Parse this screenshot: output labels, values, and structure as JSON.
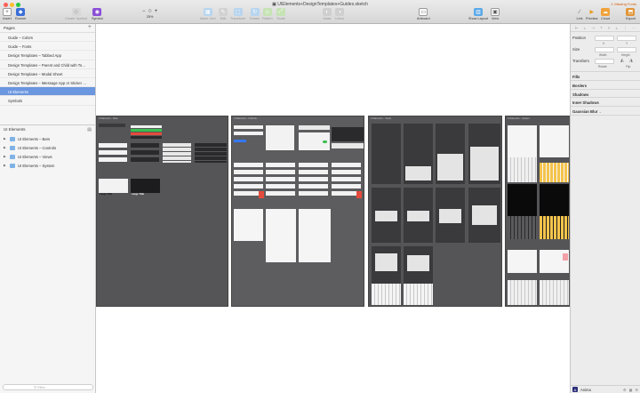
{
  "window": {
    "title": "UIElements+DesignTemplates+Guides.sketch",
    "missing_fonts": "Missing Fonts",
    "colors": {
      "close": "#fe5f57",
      "minimize": "#febc2e",
      "zoom": "#28c840"
    }
  },
  "toolbar": {
    "insert": "Insert",
    "runner": "Runner",
    "create_symbol": "Create Symbol",
    "symbol": "Symbol",
    "zoom_minus": "−",
    "zoom_plus": "+",
    "zoom_level": "25%",
    "make_grid": "Make Grid",
    "edit": "Edit",
    "transform": "Transform",
    "rotate": "Rotate",
    "flatten": "Flatten",
    "scale": "Scale",
    "mask": "Mask",
    "union": "Union",
    "artboard": "Artboard",
    "show_layout": "Show Layout",
    "view": "View",
    "link": "Link",
    "preview": "Preview",
    "cloud": "Cloud",
    "export": "Export"
  },
  "sidebar": {
    "pages_header": "Pages",
    "add": "+",
    "pages": [
      {
        "label": "Guide – Colors"
      },
      {
        "label": "Guide – Fonts"
      },
      {
        "label": "Design Templates – Tabbed App"
      },
      {
        "label": "Design Templates – Parent and Child with Tool..."
      },
      {
        "label": "Design Templates – Modal Sheet"
      },
      {
        "label": "Design Templates – iMessage App or Sticker P..."
      },
      {
        "label": "UI Elements"
      },
      {
        "label": "Symbols"
      }
    ],
    "layers_header": "UI Elements",
    "layers": [
      {
        "label": "UI Elements – Bars"
      },
      {
        "label": "UI Elements – Controls"
      },
      {
        "label": "UI Elements – Views"
      },
      {
        "label": "UI Elements – System"
      }
    ],
    "filter_placeholder": "Filter",
    "accent": "#6b96e0"
  },
  "canvas": {
    "artboard_labels": [
      "UI Elements – Bars",
      "UI Elements – Controls",
      "UI Elements – Views",
      "UI Elements – System"
    ],
    "large_title": "Large Title"
  },
  "inspector": {
    "position": "Position",
    "x": "X",
    "y": "Y",
    "size": "Size",
    "width": "Width",
    "height": "Height",
    "transform": "Transform",
    "rotate": "Rotate",
    "flip": "Flip",
    "fills": "Fills",
    "borders": "Borders",
    "shadows": "Shadows",
    "inner_shadows": "Inner Shadows",
    "gaussian_blur": "Gaussian Blur",
    "anima": "Anima"
  }
}
